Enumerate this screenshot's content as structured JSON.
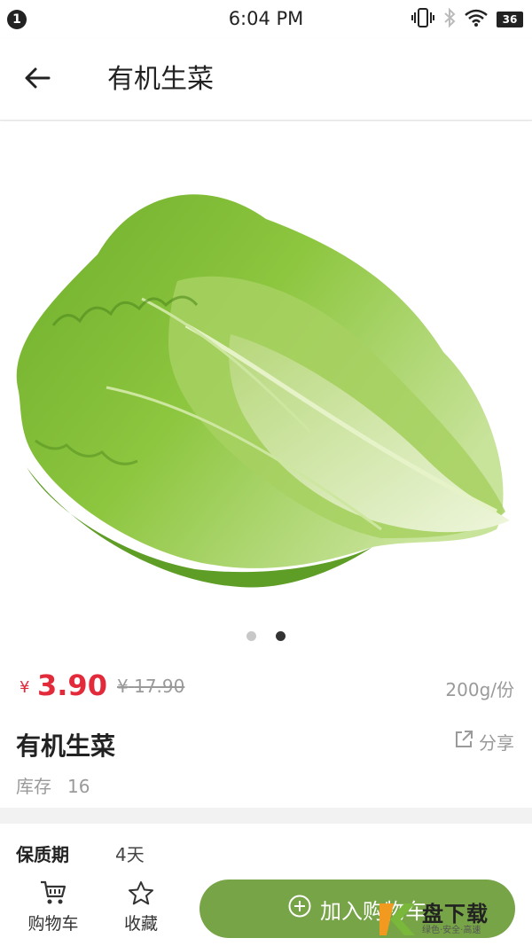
{
  "status_bar": {
    "notification_count": "1",
    "time": "6:04 PM",
    "battery": "36",
    "icons": [
      "vibrate-icon",
      "bluetooth-icon",
      "wifi-icon",
      "battery-icon"
    ]
  },
  "header": {
    "back_icon": "arrow-left-icon",
    "title": "有机生菜"
  },
  "gallery": {
    "image": "lettuce-photo",
    "dot_count": 2,
    "active_index": 1
  },
  "pricing": {
    "currency": "¥",
    "price": "3.90",
    "original_currency": "¥",
    "original_price": "17.90",
    "unit": "200g/份"
  },
  "product": {
    "name": "有机生菜",
    "share_label": "分享",
    "stock_label": "库存",
    "stock_value": "16"
  },
  "details": {
    "shelf_life_label": "保质期",
    "shelf_life_value": "4天"
  },
  "bottom_bar": {
    "cart_label": "购物车",
    "favorite_label": "收藏",
    "add_to_cart_label": "加入购物车"
  },
  "watermark": {
    "title": "盘下载",
    "subtitle": "绿色·安全·高速"
  },
  "colors": {
    "accent_red": "#e22a3a",
    "button_green": "#76a446",
    "muted_gray": "#9a9a9a"
  }
}
